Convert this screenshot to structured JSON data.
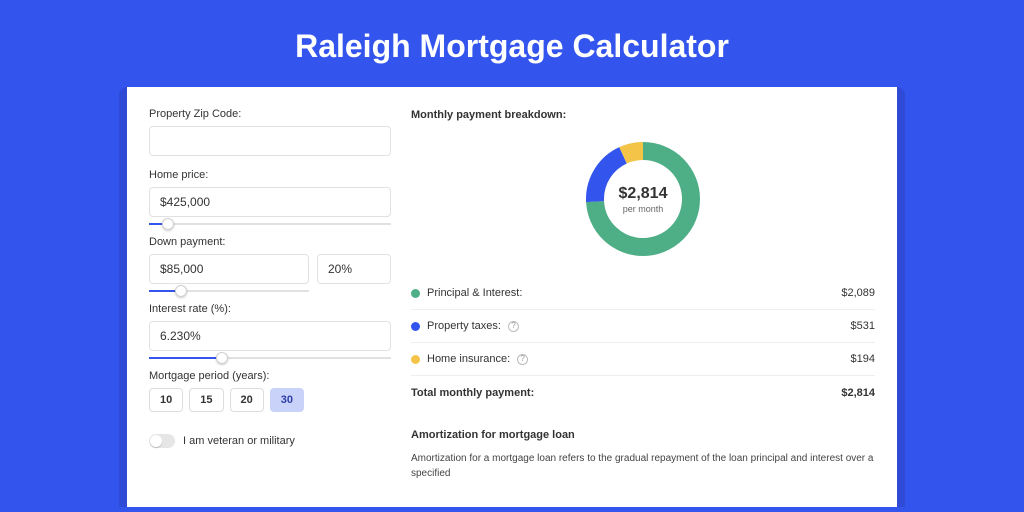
{
  "hero": {
    "title": "Raleigh Mortgage Calculator"
  },
  "form": {
    "zip": {
      "label": "Property Zip Code:",
      "value": ""
    },
    "price": {
      "label": "Home price:",
      "value": "$425,000",
      "slider_pct": 8
    },
    "down": {
      "label": "Down payment:",
      "amount": "$85,000",
      "pct": "20%",
      "slider_pct": 20
    },
    "rate": {
      "label": "Interest rate (%):",
      "value": "6.230%",
      "slider_pct": 30
    },
    "period": {
      "label": "Mortgage period (years):",
      "options": [
        "10",
        "15",
        "20",
        "30"
      ],
      "selected": "30"
    },
    "veteran": {
      "label": "I am veteran or military",
      "on": false
    }
  },
  "breakdown": {
    "title": "Monthly payment breakdown:",
    "center_value": "$2,814",
    "center_sub": "per month",
    "items": [
      {
        "label": "Principal & Interest:",
        "amount": "$2,089",
        "color": "#4eaf87",
        "pct": 74,
        "help": false
      },
      {
        "label": "Property taxes:",
        "amount": "$531",
        "color": "#3355ee",
        "pct": 19,
        "help": true
      },
      {
        "label": "Home insurance:",
        "amount": "$194",
        "color": "#f3c448",
        "pct": 7,
        "help": true
      }
    ],
    "total_label": "Total monthly payment:",
    "total_amount": "$2,814"
  },
  "amortization": {
    "title": "Amortization for mortgage loan",
    "body": "Amortization for a mortgage loan refers to the gradual repayment of the loan principal and interest over a specified"
  },
  "chart_data": {
    "type": "pie",
    "title": "Monthly payment breakdown",
    "series": [
      {
        "name": "Principal & Interest",
        "value": 2089,
        "color": "#4eaf87"
      },
      {
        "name": "Property taxes",
        "value": 531,
        "color": "#3355ee"
      },
      {
        "name": "Home insurance",
        "value": 194,
        "color": "#f3c448"
      }
    ],
    "total": 2814,
    "center_label": "$2,814 per month"
  }
}
